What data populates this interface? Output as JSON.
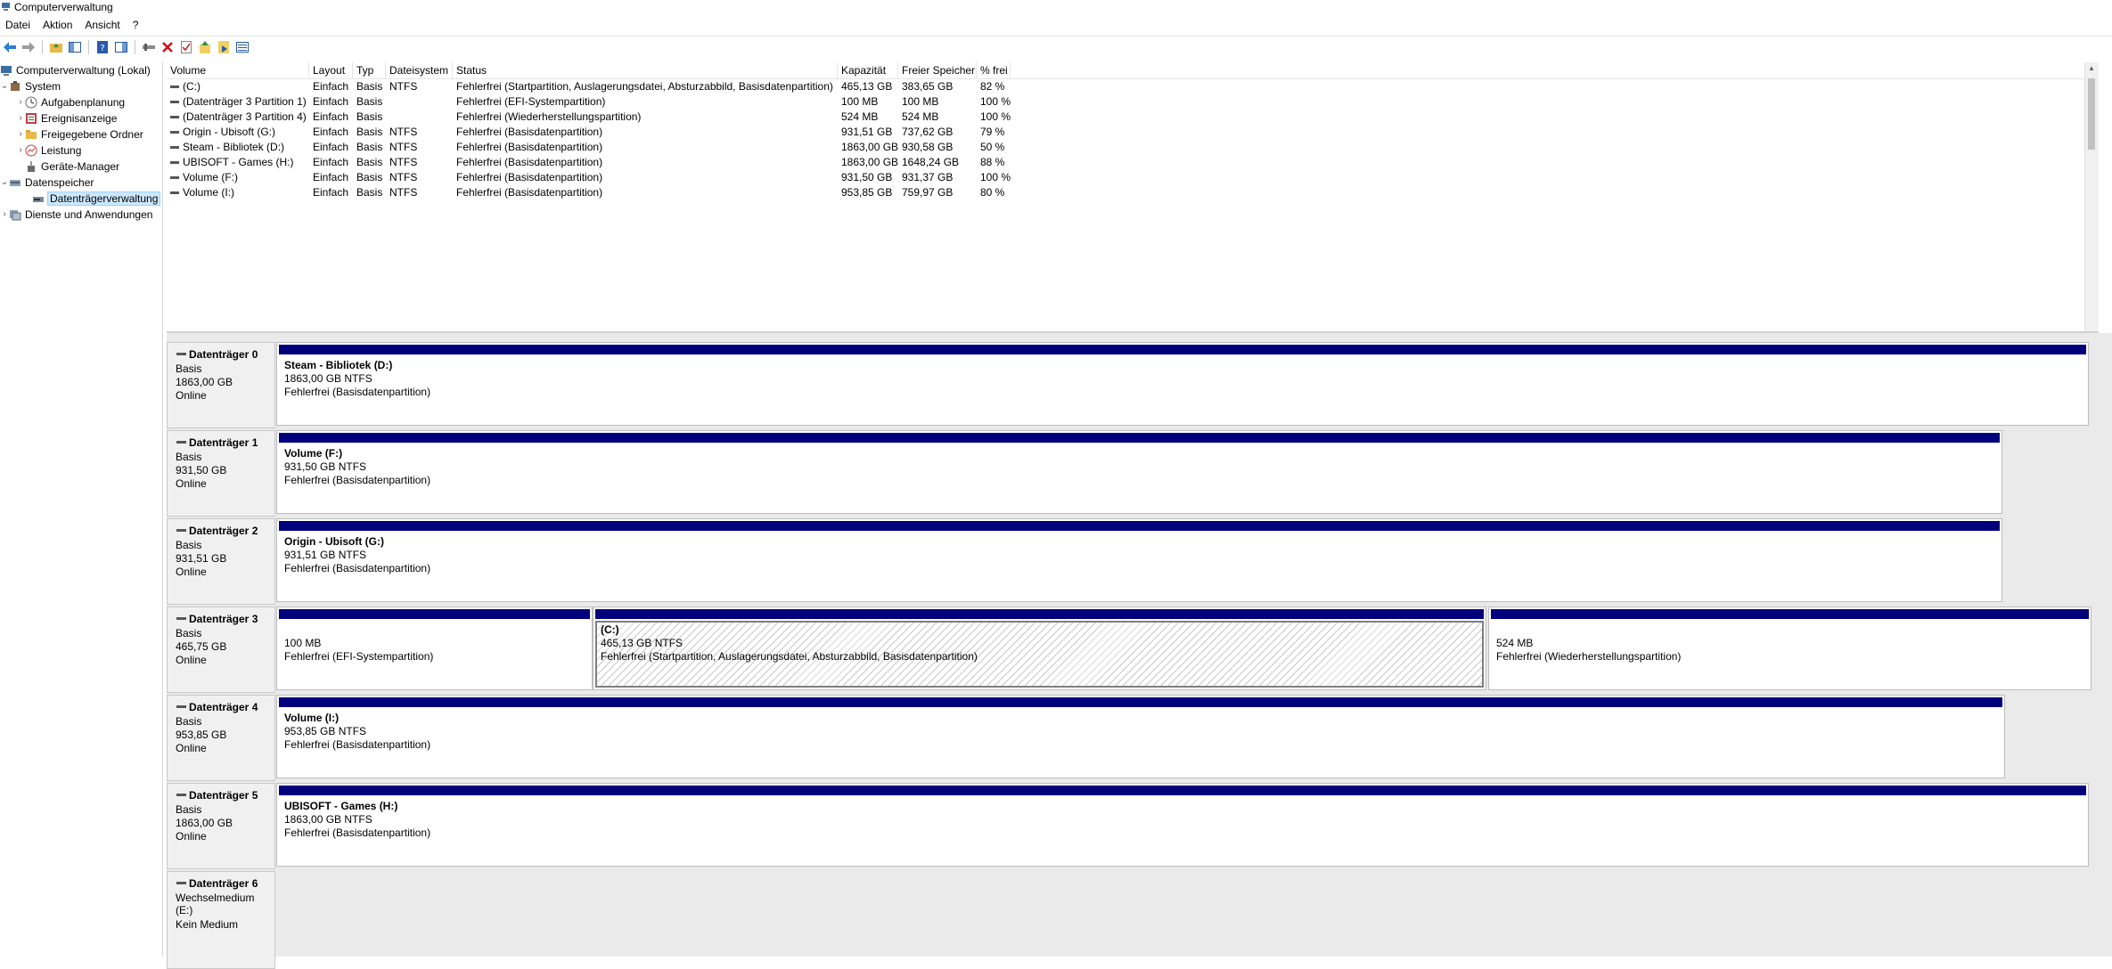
{
  "window": {
    "title": "Computerverwaltung"
  },
  "menu": [
    "Datei",
    "Aktion",
    "Ansicht",
    "?"
  ],
  "toolbar": [
    "back-icon",
    "forward-icon",
    "up-folder-icon",
    "show-hide-console-tree-icon",
    "help-icon",
    "properties-panel-icon",
    "connect-icon",
    "delete-icon",
    "checklist-icon",
    "import-icon",
    "export-icon",
    "list-view-icon"
  ],
  "tree": {
    "root": "Computerverwaltung (Lokal)",
    "system": "System",
    "aufgaben": "Aufgabenplanung",
    "ereignis": "Ereignisanzeige",
    "freigabe": "Freigegebene Ordner",
    "leistung": "Leistung",
    "geraete": "Geräte-Manager",
    "datenspeicher": "Datenspeicher",
    "datentraeger": "Datenträgerverwaltung",
    "dienste": "Dienste und Anwendungen"
  },
  "volumes": {
    "columns": [
      "Volume",
      "Layout",
      "Typ",
      "Dateisystem",
      "Status",
      "Kapazität",
      "Freier Speicher",
      "% frei"
    ],
    "rows": [
      [
        "(C:)",
        "Einfach",
        "Basis",
        "NTFS",
        "Fehlerfrei (Startpartition, Auslagerungsdatei, Absturzabbild, Basisdatenpartition)",
        "465,13 GB",
        "383,65 GB",
        "82 %"
      ],
      [
        "(Datenträger 3 Partition 1)",
        "Einfach",
        "Basis",
        "",
        "Fehlerfrei (EFI-Systempartition)",
        "100 MB",
        "100 MB",
        "100 %"
      ],
      [
        "(Datenträger 3 Partition 4)",
        "Einfach",
        "Basis",
        "",
        "Fehlerfrei (Wiederherstellungspartition)",
        "524 MB",
        "524 MB",
        "100 %"
      ],
      [
        "Origin - Ubisoft (G:)",
        "Einfach",
        "Basis",
        "NTFS",
        "Fehlerfrei (Basisdatenpartition)",
        "931,51 GB",
        "737,62 GB",
        "79 %"
      ],
      [
        "Steam - Bibliotek (D:)",
        "Einfach",
        "Basis",
        "NTFS",
        "Fehlerfrei (Basisdatenpartition)",
        "1863,00 GB",
        "930,58 GB",
        "50 %"
      ],
      [
        "UBISOFT - Games (H:)",
        "Einfach",
        "Basis",
        "NTFS",
        "Fehlerfrei (Basisdatenpartition)",
        "1863,00 GB",
        "1648,24 GB",
        "88 %"
      ],
      [
        "Volume (F:)",
        "Einfach",
        "Basis",
        "NTFS",
        "Fehlerfrei (Basisdatenpartition)",
        "931,50 GB",
        "931,37 GB",
        "100 %"
      ],
      [
        "Volume (I:)",
        "Einfach",
        "Basis",
        "NTFS",
        "Fehlerfrei (Basisdatenpartition)",
        "953,85 GB",
        "759,97 GB",
        "80 %"
      ]
    ]
  },
  "disks": [
    {
      "name": "Datenträger 0",
      "type": "Basis",
      "size": "1863,00 GB",
      "state": "Online",
      "partitions": [
        {
          "name": "Steam - Bibliotek  (D:)",
          "size": "1863,00 GB NTFS",
          "status": "Fehlerfrei (Basisdatenpartition)"
        }
      ]
    },
    {
      "name": "Datenträger 1",
      "type": "Basis",
      "size": "931,50 GB",
      "state": "Online",
      "partitions": [
        {
          "name": "Volume  (F:)",
          "size": "931,50 GB NTFS",
          "status": "Fehlerfrei (Basisdatenpartition)"
        }
      ]
    },
    {
      "name": "Datenträger 2",
      "type": "Basis",
      "size": "931,51 GB",
      "state": "Online",
      "partitions": [
        {
          "name": "Origin - Ubisoft  (G:)",
          "size": "931,51 GB NTFS",
          "status": "Fehlerfrei (Basisdatenpartition)"
        }
      ]
    },
    {
      "name": "Datenträger 3",
      "type": "Basis",
      "size": "465,75 GB",
      "state": "Online",
      "partitions": [
        {
          "name": "",
          "size": "100 MB",
          "status": "Fehlerfrei (EFI-Systempartition)"
        },
        {
          "name": "(C:)",
          "size": "465,13 GB NTFS",
          "status": "Fehlerfrei (Startpartition, Auslagerungsdatei, Absturzabbild, Basisdatenpartition)"
        },
        {
          "name": "",
          "size": "524 MB",
          "status": "Fehlerfrei (Wiederherstellungspartition)"
        }
      ]
    },
    {
      "name": "Datenträger 4",
      "type": "Basis",
      "size": "953,85 GB",
      "state": "Online",
      "partitions": [
        {
          "name": "Volume  (I:)",
          "size": "953,85 GB NTFS",
          "status": "Fehlerfrei (Basisdatenpartition)"
        }
      ]
    },
    {
      "name": "Datenträger 5",
      "type": "Basis",
      "size": "1863,00 GB",
      "state": "Online",
      "partitions": [
        {
          "name": "UBISOFT - Games  (H:)",
          "size": "1863,00 GB NTFS",
          "status": "Fehlerfrei (Basisdatenpartition)"
        }
      ]
    },
    {
      "name": "Datenträger 6",
      "type": "Wechselmedium (E:)",
      "size": "",
      "state": "Kein Medium",
      "partitions": []
    }
  ],
  "colors": {
    "partition_bar": "#00007d",
    "selection": "#cce8ff"
  }
}
